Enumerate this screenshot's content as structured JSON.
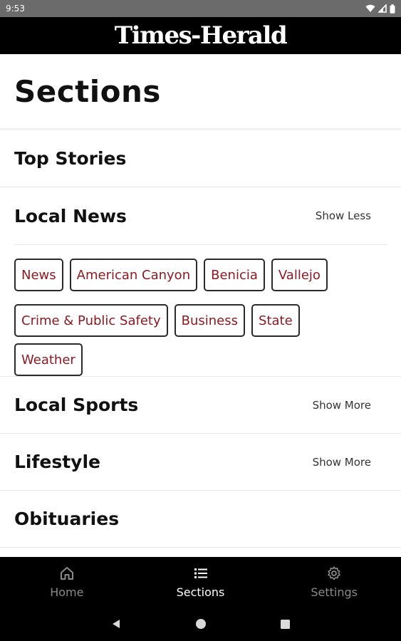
{
  "status_bar": {
    "time": "9:53",
    "icons": [
      "wifi-icon",
      "signal-icon",
      "battery-icon"
    ]
  },
  "masthead": {
    "title": "Times-Herald"
  },
  "page": {
    "title": "Sections"
  },
  "sections": [
    {
      "label": "Top Stories"
    },
    {
      "label": "Local News",
      "toggle": "Show Less",
      "subsections": [
        "News",
        "American Canyon",
        "Benicia",
        "Vallejo",
        "Crime & Public Safety",
        "Business",
        "State",
        "Weather"
      ]
    },
    {
      "label": "Local Sports",
      "toggle": "Show More"
    },
    {
      "label": "Lifestyle",
      "toggle": "Show More"
    },
    {
      "label": "Obituaries"
    }
  ],
  "bottom_nav": {
    "items": [
      {
        "label": "Home",
        "icon": "home-icon",
        "active": false
      },
      {
        "label": "Sections",
        "icon": "list-icon",
        "active": true
      },
      {
        "label": "Settings",
        "icon": "gear-icon",
        "active": false
      }
    ]
  },
  "system_nav": {
    "icons": [
      "back-icon",
      "home-circle-icon",
      "recents-icon"
    ]
  },
  "colors": {
    "masthead_bg": "#000000",
    "chip_text": "#8b1a22",
    "nav_active": "#ffffff",
    "nav_inactive": "#8a8a8a"
  }
}
